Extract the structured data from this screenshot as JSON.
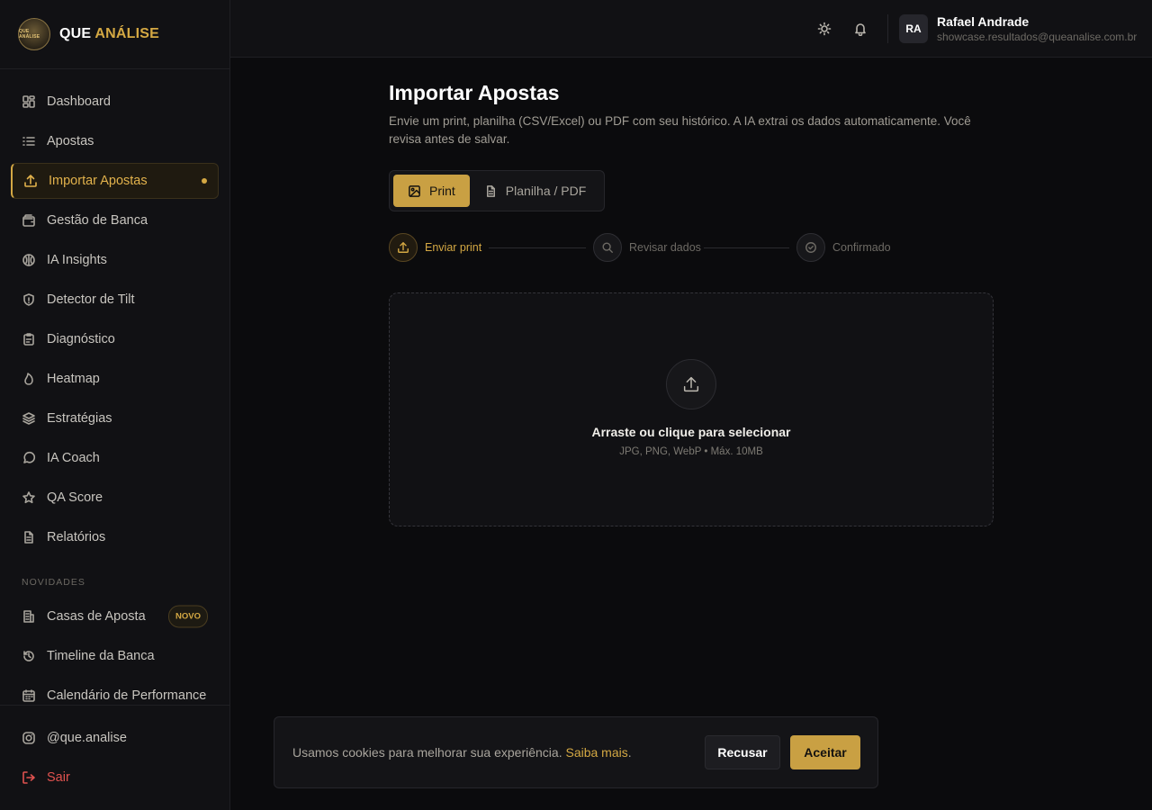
{
  "brand": {
    "name_part1": "QUE",
    "name_part2": "ANÁLISE",
    "badge_text": "QUE ANÁLISE",
    "accent_color": "#d4a843"
  },
  "sidebar": {
    "items": [
      {
        "label": "Dashboard",
        "icon": "dashboard-icon"
      },
      {
        "label": "Apostas",
        "icon": "list-icon"
      },
      {
        "label": "Importar Apostas",
        "icon": "upload-icon",
        "active": true
      },
      {
        "label": "Gestão de Banca",
        "icon": "wallet-icon"
      },
      {
        "label": "IA Insights",
        "icon": "brain-icon"
      },
      {
        "label": "Detector de Tilt",
        "icon": "shield-icon"
      },
      {
        "label": "Diagnóstico",
        "icon": "clipboard-icon"
      },
      {
        "label": "Heatmap",
        "icon": "flame-icon"
      },
      {
        "label": "Estratégias",
        "icon": "layers-icon"
      },
      {
        "label": "IA Coach",
        "icon": "chat-icon"
      },
      {
        "label": "QA Score",
        "icon": "star-icon"
      },
      {
        "label": "Relatórios",
        "icon": "file-icon"
      }
    ],
    "section_novidades": "NOVIDADES",
    "novidades": [
      {
        "label": "Casas de Aposta",
        "icon": "building-icon",
        "badge": "NOVO"
      },
      {
        "label": "Timeline da Banca",
        "icon": "history-icon"
      },
      {
        "label": "Calendário de Performance",
        "icon": "calendar-icon"
      }
    ],
    "footer": [
      {
        "label": "@que.analise",
        "icon": "instagram-icon"
      },
      {
        "label": "Sair",
        "icon": "logout-icon"
      }
    ]
  },
  "topbar": {
    "theme_icon": "sun-icon",
    "notification_icon": "bell-icon",
    "user": {
      "initials": "RA",
      "name": "Rafael Andrade",
      "email": "showcase.resultados@queanalise.com.br"
    }
  },
  "main": {
    "title": "Importar Apostas",
    "description": "Envie um print, planilha (CSV/Excel) ou PDF com seu histórico. A IA extrai os dados automaticamente. Você revisa antes de salvar.",
    "tabs": [
      {
        "label": "Print",
        "icon": "image-icon",
        "active": true
      },
      {
        "label": "Planilha / PDF",
        "icon": "document-icon"
      }
    ],
    "steps": [
      {
        "label": "Enviar print",
        "icon": "upload-icon",
        "active": true
      },
      {
        "label": "Revisar dados",
        "icon": "search-icon"
      },
      {
        "label": "Confirmado",
        "icon": "check-circle-icon"
      }
    ],
    "dropzone": {
      "title": "Arraste ou clique para selecionar",
      "subtitle": "JPG, PNG, WebP • Máx. 10MB"
    }
  },
  "cookie": {
    "text": "Usamos cookies para melhorar sua experiência.",
    "link": "Saiba mais",
    "period": ".",
    "refuse": "Recusar",
    "accept": "Aceitar"
  }
}
